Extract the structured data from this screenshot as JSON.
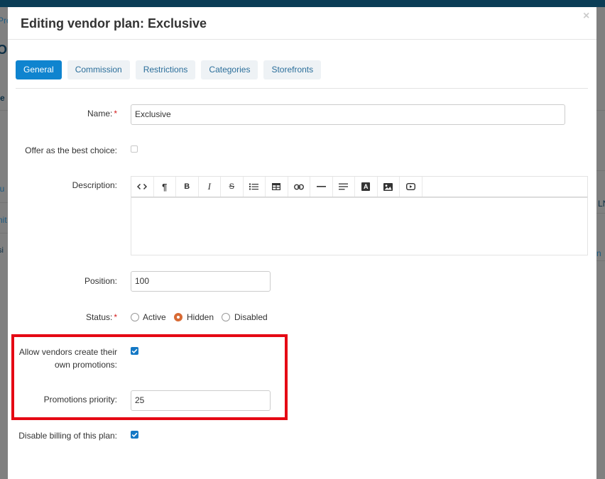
{
  "background": {
    "fragments": [
      "Pro",
      "Ol",
      "e",
      "iu",
      "nit",
      "si",
      "LN",
      "n"
    ]
  },
  "modal": {
    "title": "Editing vendor plan: Exclusive",
    "close_symbol": "×"
  },
  "tabs": [
    {
      "label": "General",
      "active": true
    },
    {
      "label": "Commission",
      "active": false
    },
    {
      "label": "Restrictions",
      "active": false
    },
    {
      "label": "Categories",
      "active": false
    },
    {
      "label": "Storefronts",
      "active": false
    }
  ],
  "form": {
    "name": {
      "label": "Name:",
      "required_mark": "*",
      "value": "Exclusive"
    },
    "best_choice": {
      "label": "Offer as the best choice:",
      "checked": false
    },
    "description": {
      "label": "Description:",
      "value": ""
    },
    "position": {
      "label": "Position:",
      "value": "100"
    },
    "status": {
      "label": "Status:",
      "required_mark": "*",
      "options": [
        {
          "label": "Active",
          "selected": false
        },
        {
          "label": "Hidden",
          "selected": true
        },
        {
          "label": "Disabled",
          "selected": false
        }
      ]
    },
    "allow_promotions": {
      "label_line1": "Allow vendors create their",
      "label_line2": "own promotions:",
      "checked": true
    },
    "promotions_priority": {
      "label": "Promotions priority:",
      "value": "25"
    },
    "disable_billing": {
      "label": "Disable billing of this plan:",
      "checked": true
    }
  },
  "editor_toolbar": [
    {
      "icon": "code-view-icon",
      "glyph": "<>"
    },
    {
      "icon": "paragraph-icon",
      "glyph": "¶"
    },
    {
      "icon": "bold-icon",
      "glyph": "B"
    },
    {
      "icon": "italic-icon",
      "glyph": "I"
    },
    {
      "icon": "strikethrough-icon",
      "glyph": "S"
    },
    {
      "icon": "unordered-list-icon",
      "glyph": ""
    },
    {
      "icon": "table-icon",
      "glyph": ""
    },
    {
      "icon": "link-icon",
      "glyph": ""
    },
    {
      "icon": "horizontal-rule-icon",
      "glyph": ""
    },
    {
      "icon": "align-icon",
      "glyph": ""
    },
    {
      "icon": "font-color-icon",
      "glyph": "A"
    },
    {
      "icon": "image-icon",
      "glyph": ""
    },
    {
      "icon": "video-icon",
      "glyph": ""
    }
  ],
  "colors": {
    "primary": "#0f84cf",
    "tab_bg": "#eef2f5",
    "tab_text": "#2b6e9a",
    "required": "#d21c1c",
    "radio_selected": "#d86a34",
    "checkbox_checked": "#1478c5",
    "highlight_border": "#e50914"
  }
}
